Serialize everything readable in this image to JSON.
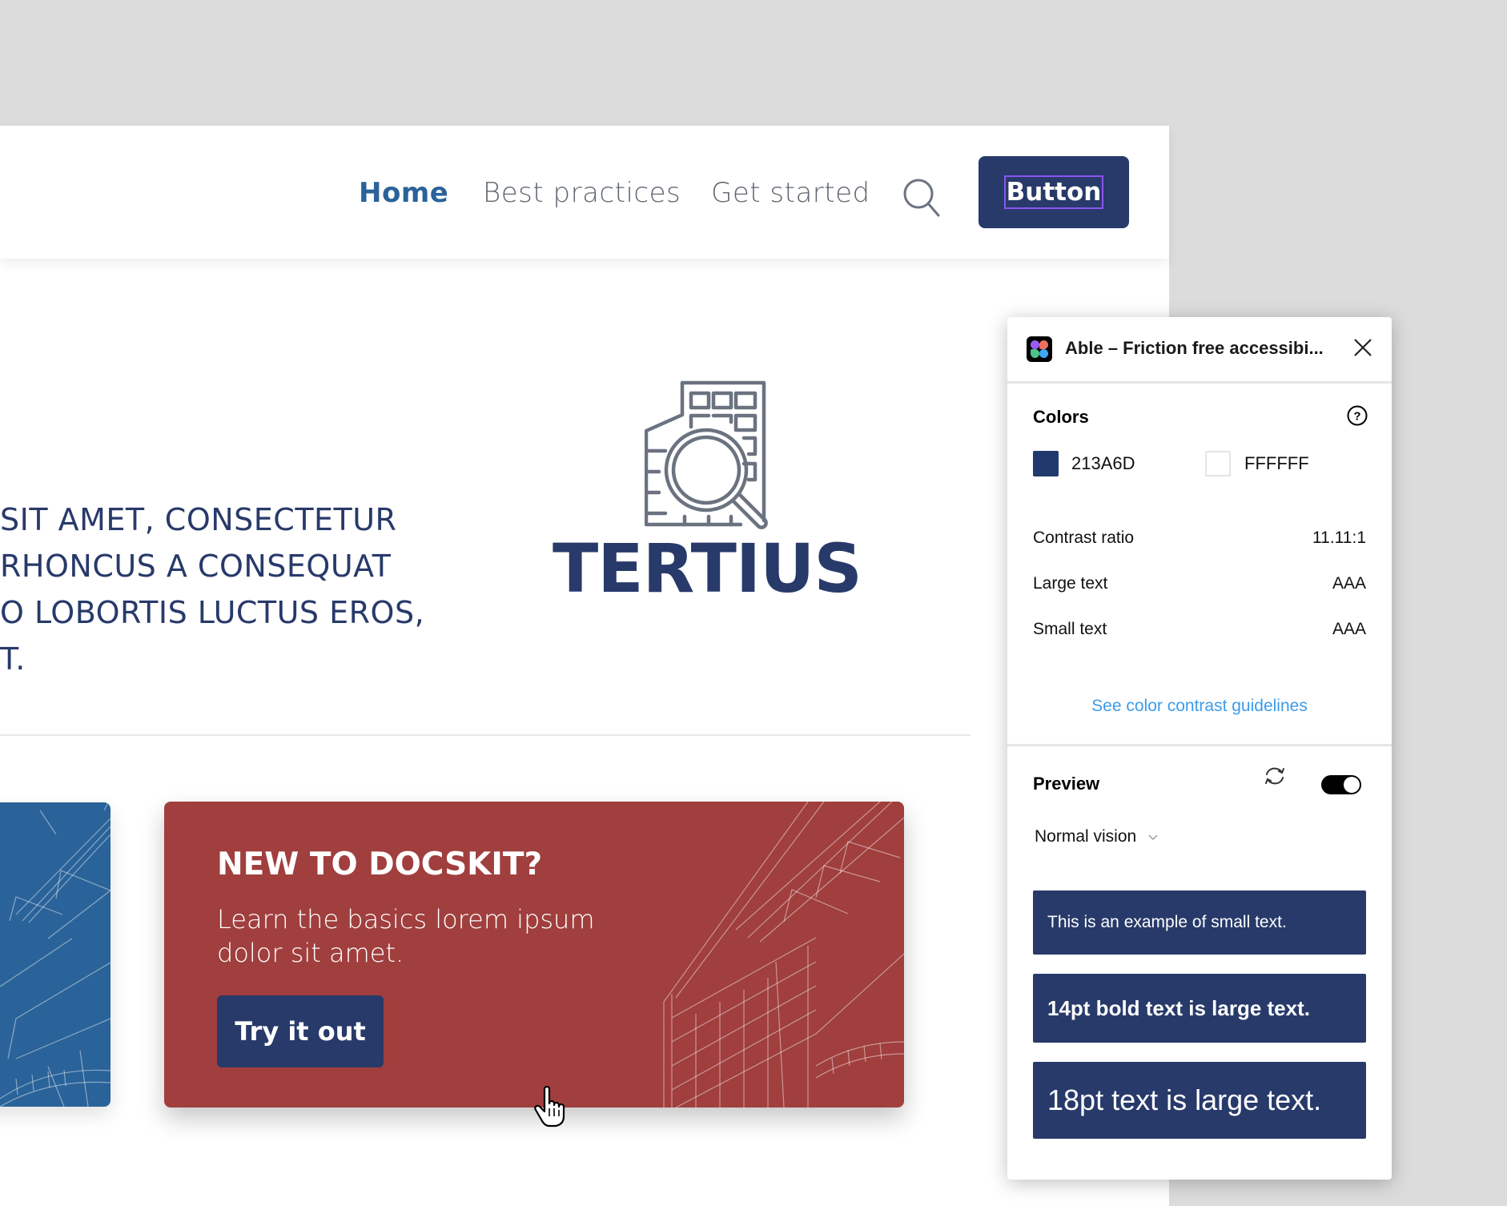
{
  "navbar": {
    "links": [
      {
        "label": "Home",
        "active": true
      },
      {
        "label": "Best practices",
        "active": false
      },
      {
        "label": "Get started",
        "active": false
      }
    ],
    "search_icon": "search-icon",
    "button_label": "Button"
  },
  "hero": {
    "lines": [
      "SIT AMET, CONSECTETUR",
      "RHONCUS A CONSEQUAT",
      "O LOBORTIS LUCTUS EROS,",
      "T."
    ],
    "logo_icon": "building-magnifier-icon",
    "logo_text": "TERTIUS"
  },
  "cards": {
    "red": {
      "title": "NEW TO DOCSKIT?",
      "body": "Learn the basics lorem ipsum dolor sit amet.",
      "button_label": "Try it out"
    }
  },
  "plugin": {
    "title": "Able – Friction free accessibi...",
    "colors_label": "Colors",
    "foreground": {
      "hex": "213A6D",
      "color": "#213A6D"
    },
    "background": {
      "hex": "FFFFFF",
      "color": "#FFFFFF"
    },
    "contrast_ratio_label": "Contrast ratio",
    "contrast_ratio_value": "11.11:1",
    "large_text_label": "Large text",
    "large_text_value": "AAA",
    "small_text_label": "Small text",
    "small_text_value": "AAA",
    "guidelines_link": "See color contrast guidelines",
    "preview_label": "Preview",
    "preview_toggle_on": true,
    "vision_mode": "Normal vision",
    "samples": [
      "This is an example of small text.",
      "14pt bold text is large text.",
      "18pt text is large text."
    ]
  },
  "colors": {
    "navy": "#283A6A",
    "blue_card": "#2A6399",
    "red_card": "#A03F3E",
    "link_blue": "#3D9BE9",
    "active_nav": "#2A6399"
  }
}
